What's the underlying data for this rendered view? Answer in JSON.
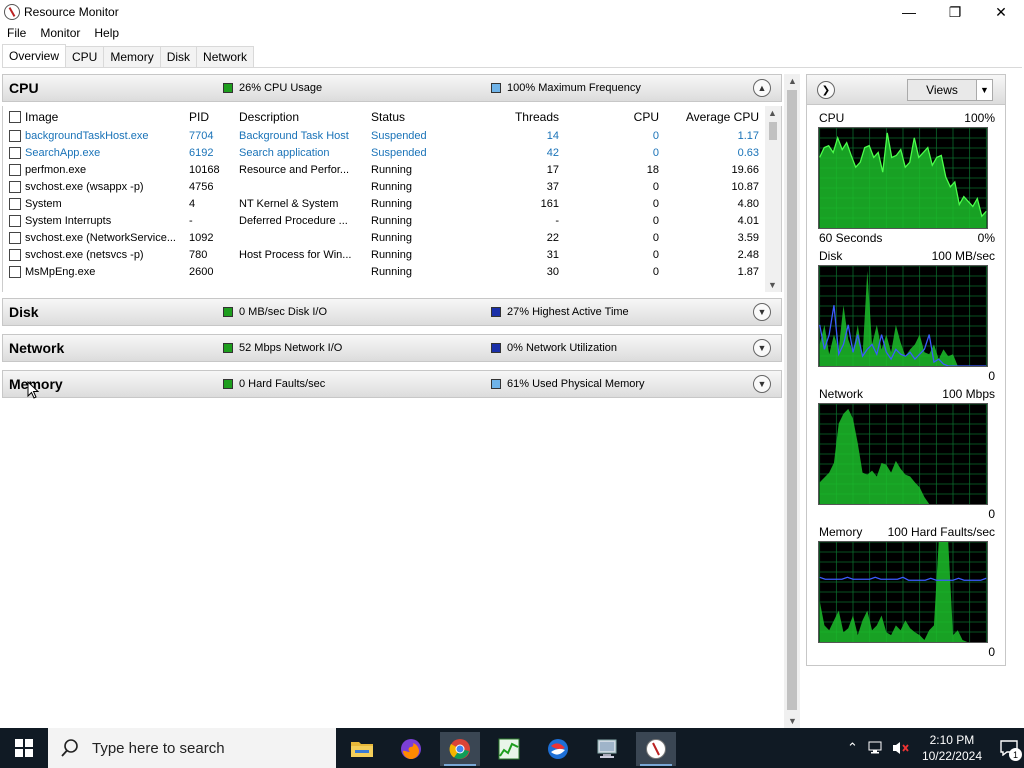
{
  "window": {
    "title": "Resource Monitor"
  },
  "menu": [
    "File",
    "Monitor",
    "Help"
  ],
  "tabs": [
    "Overview",
    "CPU",
    "Memory",
    "Disk",
    "Network"
  ],
  "cpu_section": {
    "title": "CPU",
    "stat1": "26% CPU Usage",
    "stat2": "100% Maximum Frequency",
    "stat1_color": "#1e9e1e",
    "stat2_color": "#6fb3e8",
    "columns": [
      "Image",
      "PID",
      "Description",
      "Status",
      "Threads",
      "CPU",
      "Average CPU"
    ],
    "rows": [
      [
        "backgroundTaskHost.exe",
        "7704",
        "Background Task Host",
        "Suspended",
        "14",
        "0",
        "1.17"
      ],
      [
        "SearchApp.exe",
        "6192",
        "Search application",
        "Suspended",
        "42",
        "0",
        "0.63"
      ],
      [
        "perfmon.exe",
        "10168",
        "Resource and Perfor...",
        "Running",
        "17",
        "18",
        "19.66"
      ],
      [
        "svchost.exe (wsappx -p)",
        "4756",
        "",
        "Running",
        "37",
        "0",
        "10.87"
      ],
      [
        "System",
        "4",
        "NT Kernel & System",
        "Running",
        "161",
        "0",
        "4.80"
      ],
      [
        "System Interrupts",
        "-",
        "Deferred Procedure ...",
        "Running",
        "-",
        "0",
        "4.01"
      ],
      [
        "svchost.exe (NetworkService...",
        "1092",
        "",
        "Running",
        "22",
        "0",
        "3.59"
      ],
      [
        "svchost.exe (netsvcs -p)",
        "780",
        "Host Process for Win...",
        "Running",
        "31",
        "0",
        "2.48"
      ],
      [
        "MsMpEng.exe",
        "2600",
        "",
        "Running",
        "30",
        "0",
        "1.87"
      ]
    ]
  },
  "disk_section": {
    "title": "Disk",
    "stat1": "0 MB/sec Disk I/O",
    "stat2": "27% Highest Active Time",
    "stat1_color": "#1e9e1e",
    "stat2_color": "#1a2fa8"
  },
  "network_section": {
    "title": "Network",
    "stat1": "52 Mbps Network I/O",
    "stat2": "0% Network Utilization",
    "stat1_color": "#1e9e1e",
    "stat2_color": "#1a2fa8"
  },
  "memory_section": {
    "title": "Memory",
    "stat1": "0 Hard Faults/sec",
    "stat2": "61% Used Physical Memory",
    "stat1_color": "#1e9e1e",
    "stat2_color": "#6fb3e8"
  },
  "right_panel": {
    "views_label": "Views",
    "graphs": [
      {
        "name": "CPU",
        "top_right": "100%",
        "bottom_left": "60 Seconds",
        "bottom_right": "0%"
      },
      {
        "name": "Disk",
        "top_right": "100 MB/sec",
        "bottom_left": "",
        "bottom_right": "0"
      },
      {
        "name": "Network",
        "top_right": "100 Mbps",
        "bottom_left": "",
        "bottom_right": "0"
      },
      {
        "name": "Memory",
        "top_right": "100 Hard Faults/sec",
        "bottom_left": "",
        "bottom_right": "0"
      }
    ]
  },
  "taskbar": {
    "search_placeholder": "Type here to search",
    "time": "2:10 PM",
    "date": "10/22/2024",
    "notification_count": "1"
  }
}
